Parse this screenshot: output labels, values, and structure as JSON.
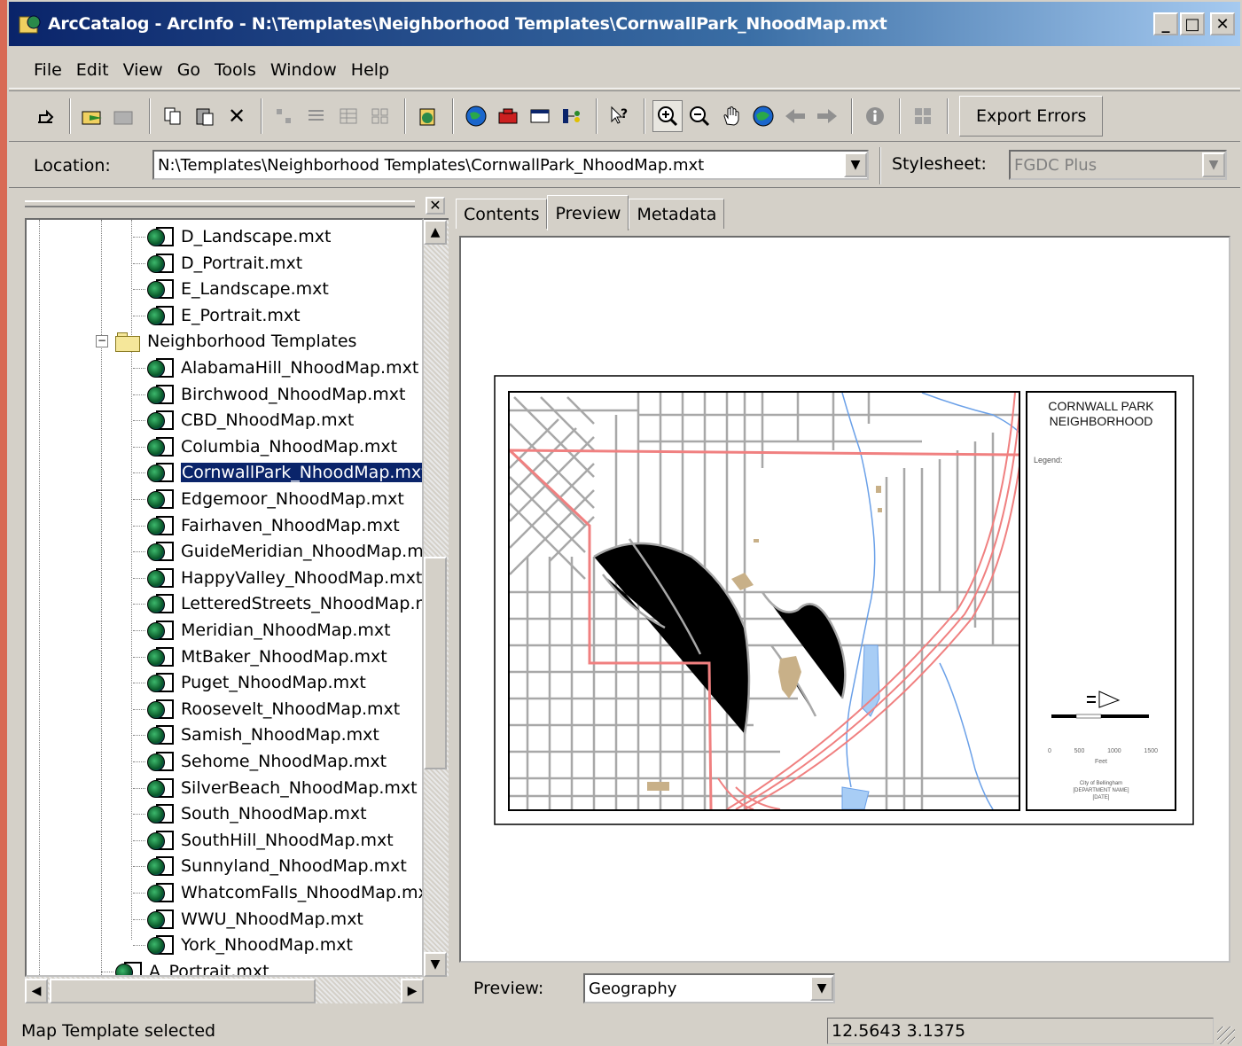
{
  "window": {
    "title": "ArcCatalog - ArcInfo - N:\\Templates\\Neighborhood Templates\\CornwallPark_NhoodMap.mxt",
    "minimize": "_",
    "maximize": "□",
    "close": "✕"
  },
  "menu": [
    "File",
    "Edit",
    "View",
    "Go",
    "Tools",
    "Window",
    "Help"
  ],
  "toolbar": {
    "export_errors_label": "Export Errors"
  },
  "location": {
    "label": "Location:",
    "value": "N:\\Templates\\Neighborhood Templates\\CornwallPark_NhoodMap.mxt"
  },
  "stylesheet": {
    "label": "Stylesheet:",
    "value": "FGDC Plus"
  },
  "tree": {
    "pre_items": [
      "D_Landscape.mxt",
      "D_Portrait.mxt",
      "E_Landscape.mxt",
      "E_Portrait.mxt"
    ],
    "folder": "Neighborhood Templates",
    "folder_expander": "−",
    "items": [
      "AlabamaHill_NhoodMap.mxt",
      "Birchwood_NhoodMap.mxt",
      "CBD_NhoodMap.mxt",
      "Columbia_NhoodMap.mxt",
      "CornwallPark_NhoodMap.mxt",
      "Edgemoor_NhoodMap.mxt",
      "Fairhaven_NhoodMap.mxt",
      "GuideMeridian_NhoodMap.mxt",
      "HappyValley_NhoodMap.mxt",
      "LetteredStreets_NhoodMap.mxt",
      "Meridian_NhoodMap.mxt",
      "MtBaker_NhoodMap.mxt",
      "Puget_NhoodMap.mxt",
      "Roosevelt_NhoodMap.mxt",
      "Samish_NhoodMap.mxt",
      "Sehome_NhoodMap.mxt",
      "SilverBeach_NhoodMap.mxt",
      "South_NhoodMap.mxt",
      "SouthHill_NhoodMap.mxt",
      "Sunnyland_NhoodMap.mxt",
      "WhatcomFalls_NhoodMap.mxt",
      "WWU_NhoodMap.mxt",
      "York_NhoodMap.mxt"
    ],
    "selected_index": 4,
    "post_item": "A_Portrait.mxt"
  },
  "tabs": [
    "Contents",
    "Preview",
    "Metadata"
  ],
  "active_tab": "Preview",
  "map": {
    "title_line1": "CORNWALL PARK",
    "title_line2": "NEIGHBORHOOD",
    "legend": "Legend:",
    "scale_ticks": [
      "0",
      "500",
      "1000",
      "1500"
    ],
    "scale_unit": "Feet",
    "credit1": "City of Bellingham",
    "credit2": "[DEPARTMENT NAME]",
    "credit3": "[DATE]",
    "colors": {
      "boundary": "#f08080",
      "streets": "#a8a8a8",
      "water": "#6aa0e8",
      "parks": "#c8b088"
    }
  },
  "preview_control": {
    "label": "Preview:",
    "value": "Geography"
  },
  "status": {
    "message": "Map Template selected",
    "coords": "12.5643  3.1375"
  }
}
